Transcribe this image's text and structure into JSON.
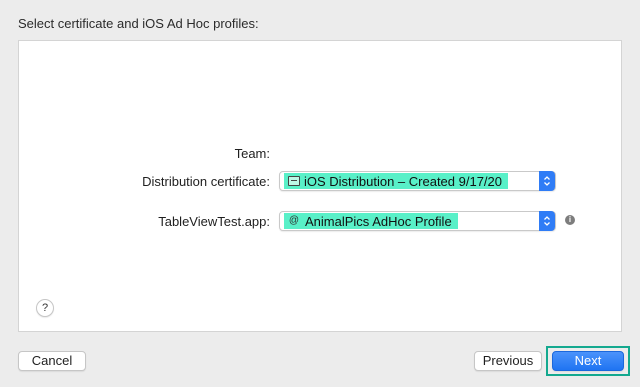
{
  "header": {
    "title": "Select certificate and iOS Ad Hoc profiles:"
  },
  "form": {
    "team_label": "Team:",
    "distribution_certificate_label": "Distribution certificate:",
    "distribution_certificate_value": "iOS Distribution – Created 9/17/20",
    "app_label": "TableViewTest.app:",
    "app_profile_value": "AnimalPics AdHoc Profile",
    "app_profile_icon_glyph": "@"
  },
  "help": {
    "label": "?"
  },
  "footer": {
    "cancel_label": "Cancel",
    "previous_label": "Previous",
    "next_label": "Next"
  },
  "colors": {
    "highlight": "#59f0c8",
    "accent": "#2f7cf6",
    "next_frame": "#14a98f"
  },
  "icons": {
    "certificate": "certificate-icon",
    "profile": "profile-icon",
    "info": "info-icon",
    "stepper": "up-down-chevron-icon"
  }
}
